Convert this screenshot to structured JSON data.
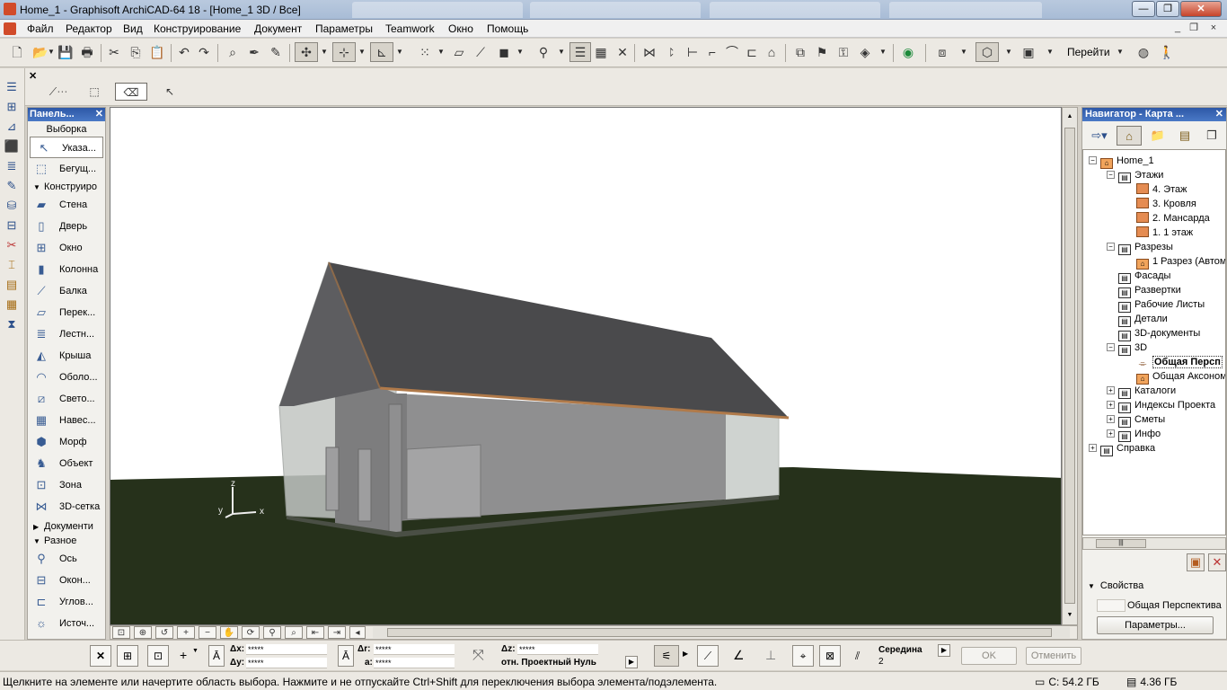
{
  "window": {
    "title": "Home_1 - Graphisoft ArchiCAD-64 18 - [Home_1 3D / Все]",
    "min_glyph": "—",
    "max_glyph": "❐",
    "close_glyph": "✕"
  },
  "menubar": {
    "items": [
      "Файл",
      "Редактор",
      "Вид",
      "Конструирование",
      "Документ",
      "Параметры",
      "Teamwork",
      "Окно",
      "Помощь"
    ],
    "mdi_min": "_",
    "mdi_restore": "❐",
    "mdi_close": "×"
  },
  "toolbar": {
    "goto_label": "Перейти"
  },
  "toolbox": {
    "title": "Панель...",
    "close_glyph": "✕",
    "selection_title": "Выборка",
    "selection_tools": [
      {
        "label": "Указа...",
        "icon": "arrow-pointer-icon"
      },
      {
        "label": "Бегущ...",
        "icon": "marquee-icon"
      }
    ],
    "construction_group": "Конструиро",
    "construction_tools": [
      {
        "label": "Стена",
        "icon": "wall-icon"
      },
      {
        "label": "Дверь",
        "icon": "door-icon"
      },
      {
        "label": "Окно",
        "icon": "window-icon"
      },
      {
        "label": "Колонна",
        "icon": "column-icon"
      },
      {
        "label": "Балка",
        "icon": "beam-icon"
      },
      {
        "label": "Перек...",
        "icon": "slab-icon"
      },
      {
        "label": "Лестн...",
        "icon": "stair-icon"
      },
      {
        "label": "Крыша",
        "icon": "roof-icon"
      },
      {
        "label": "Оболо...",
        "icon": "shell-icon"
      },
      {
        "label": "Свето...",
        "icon": "skylight-icon"
      },
      {
        "label": "Навес...",
        "icon": "curtain-wall-icon"
      },
      {
        "label": "Морф",
        "icon": "morph-icon"
      },
      {
        "label": "Объект",
        "icon": "object-icon"
      },
      {
        "label": "Зона",
        "icon": "zone-icon"
      },
      {
        "label": "3D-сетка",
        "icon": "mesh-icon"
      }
    ],
    "document_group": "Документи",
    "misc_group": "Разное",
    "misc_tools": [
      {
        "label": "Ось",
        "icon": "grid-axis-icon"
      },
      {
        "label": "Окон...",
        "icon": "window-object-icon"
      },
      {
        "label": "Углов...",
        "icon": "corner-window-icon"
      },
      {
        "label": "Источ...",
        "icon": "lamp-icon"
      }
    ]
  },
  "viewport": {
    "axis_z": "z",
    "axis_y": "y",
    "axis_x": "x",
    "colors": {
      "sky": "#ffffff",
      "ground": "#26311b",
      "roof": "#4a4a4c",
      "wall": "#8f8f90",
      "glass": "#c7cbc8"
    }
  },
  "navigator": {
    "title": "Навигатор - Карта ...",
    "close_glyph": "✕",
    "tree": [
      {
        "label": "Home_1",
        "level": 0,
        "exp": "−",
        "icon": "home"
      },
      {
        "label": "Этажи",
        "level": 1,
        "exp": "−",
        "icon": "doc"
      },
      {
        "label": "4. Этаж",
        "level": 2,
        "exp": "",
        "icon": "story"
      },
      {
        "label": "3. Кровля",
        "level": 2,
        "exp": "",
        "icon": "story"
      },
      {
        "label": "2. Мансарда",
        "level": 2,
        "exp": "",
        "icon": "story"
      },
      {
        "label": "1.  1 этаж",
        "level": 2,
        "exp": "",
        "icon": "story"
      },
      {
        "label": "Разрезы",
        "level": 1,
        "exp": "−",
        "icon": "doc"
      },
      {
        "label": "1 Разрез (Автом",
        "level": 2,
        "exp": "",
        "icon": "home"
      },
      {
        "label": "Фасады",
        "level": 1,
        "exp": "",
        "icon": "doc"
      },
      {
        "label": "Развертки",
        "level": 1,
        "exp": "",
        "icon": "doc"
      },
      {
        "label": "Рабочие Листы",
        "level": 1,
        "exp": "",
        "icon": "doc"
      },
      {
        "label": "Детали",
        "level": 1,
        "exp": "",
        "icon": "doc"
      },
      {
        "label": "3D-документы",
        "level": 1,
        "exp": "",
        "icon": "doc"
      },
      {
        "label": "3D",
        "level": 1,
        "exp": "−",
        "icon": "doc"
      },
      {
        "label": "Общая Персп",
        "level": 2,
        "exp": "",
        "icon": "camera",
        "selected": true
      },
      {
        "label": "Общая Аксоном",
        "level": 2,
        "exp": "",
        "icon": "home"
      },
      {
        "label": "Каталоги",
        "level": 1,
        "exp": "+",
        "icon": "doc"
      },
      {
        "label": "Индексы Проекта",
        "level": 1,
        "exp": "+",
        "icon": "doc"
      },
      {
        "label": "Сметы",
        "level": 1,
        "exp": "+",
        "icon": "doc"
      },
      {
        "label": "Инфо",
        "level": 1,
        "exp": "+",
        "icon": "doc"
      },
      {
        "label": "Справка",
        "level": 0,
        "exp": "+",
        "icon": "doc"
      }
    ],
    "properties_label": "Свойства",
    "properties_value": "Общая Перспектива",
    "params_button": "Параметры..."
  },
  "infobar": {
    "dx_label": "Δx:",
    "dx_value": "*****",
    "dy_label": "Δy:",
    "dy_value": "*****",
    "dr_label": "Δr:",
    "dr_value": "*****",
    "a_label": "a:",
    "a_value": "*****",
    "dz_label": "Δz:",
    "dz_value": "*****",
    "ref_label": "отн. Проектный Нуль",
    "mid_label": "Середина",
    "mid_value": "2",
    "ok_button": "OK",
    "cancel_button": "Отменить"
  },
  "statusbar": {
    "hint": "Щелкните на элементе или начертите область выбора. Нажмите и не отпускайте Ctrl+Shift для переключения выбора элемента/подэлемента.",
    "disk": "C: 54.2 ГБ",
    "memory": "4.36 ГБ"
  }
}
